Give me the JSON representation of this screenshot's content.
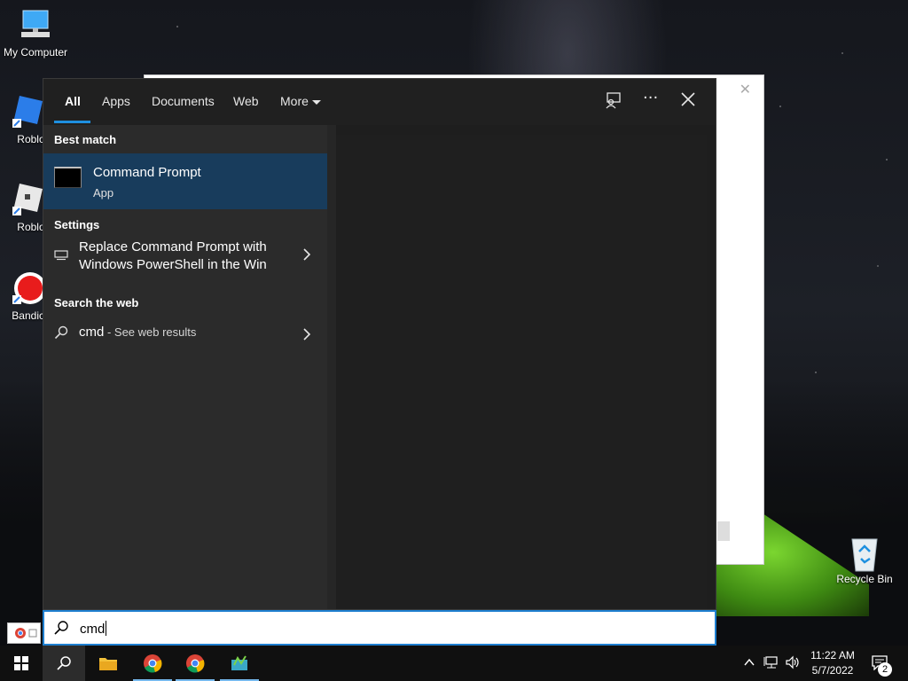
{
  "desktop": {
    "icons": [
      {
        "label": "My Computer"
      },
      {
        "label": "Roblox S"
      },
      {
        "label": "Roblox P"
      },
      {
        "label": "Bandic"
      },
      {
        "label": "Recycle Bin"
      }
    ]
  },
  "search_panel": {
    "tabs": [
      {
        "label": "All",
        "active": true
      },
      {
        "label": "Apps"
      },
      {
        "label": "Documents"
      },
      {
        "label": "Web"
      },
      {
        "label": "More"
      }
    ],
    "top_icons": [
      "feedback-icon",
      "more-options-icon",
      "close-icon"
    ],
    "best_match": {
      "heading": "Best match",
      "title": "Command Prompt",
      "subtitle": "App"
    },
    "settings": {
      "heading": "Settings",
      "line1": "Replace Command Prompt with",
      "line2": "Windows PowerShell in the Win"
    },
    "web": {
      "heading": "Search the web",
      "query": "cmd",
      "suffix": " - See web results"
    }
  },
  "search_box": {
    "value": "cmd"
  },
  "taskbar": {
    "apps": [
      "start-icon",
      "search-icon",
      "file-explorer-icon",
      "chrome-icon",
      "chrome-icon",
      "app-icon"
    ],
    "time": "11:22 AM",
    "date": "5/7/2022",
    "notification_count": "2"
  },
  "colors": {
    "accent": "#1e90e0",
    "selected_row": "#183c5c",
    "panel_bg": "#2b2b2b"
  }
}
